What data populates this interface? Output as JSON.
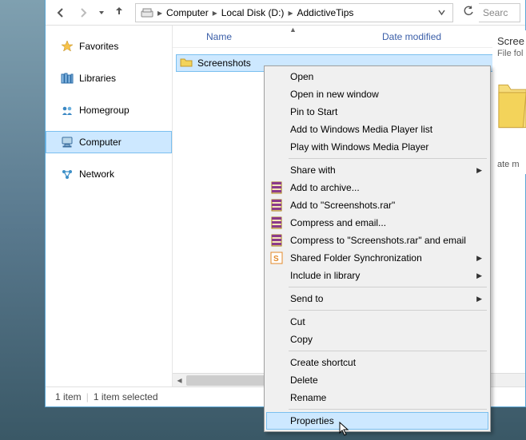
{
  "breadcrumb": {
    "root_icon": "drive",
    "items": [
      "Computer",
      "Local Disk (D:)",
      "AddictiveTips"
    ]
  },
  "search": {
    "placeholder": "Searc"
  },
  "nav_pane": {
    "items": [
      {
        "label": "Favorites",
        "icon": "star"
      },
      {
        "label": "Libraries",
        "icon": "libraries"
      },
      {
        "label": "Homegroup",
        "icon": "homegroup"
      },
      {
        "label": "Computer",
        "icon": "computer",
        "selected": true
      },
      {
        "label": "Network",
        "icon": "network"
      }
    ]
  },
  "columns": {
    "name": "Name",
    "date": "Date modified"
  },
  "file_list": {
    "items": [
      {
        "name": "Screenshots",
        "type": "folder"
      }
    ]
  },
  "preview": {
    "title": "Scree",
    "type_line": "File fol",
    "date_line": "ate m"
  },
  "statusbar": {
    "count": "1 item",
    "selection": "1 item selected"
  },
  "context_menu": {
    "groups": [
      [
        {
          "label": "Open"
        },
        {
          "label": "Open in new window"
        },
        {
          "label": "Pin to Start"
        },
        {
          "label": "Add to Windows Media Player list"
        },
        {
          "label": "Play with Windows Media Player"
        }
      ],
      [
        {
          "label": "Share with",
          "submenu": true
        },
        {
          "label": "Add to archive...",
          "icon": "rar"
        },
        {
          "label": "Add to \"Screenshots.rar\"",
          "icon": "rar"
        },
        {
          "label": "Compress and email...",
          "icon": "rar"
        },
        {
          "label": "Compress to \"Screenshots.rar\" and email",
          "icon": "rar"
        },
        {
          "label": "Shared Folder Synchronization",
          "icon": "s",
          "submenu": true
        },
        {
          "label": "Include in library",
          "submenu": true
        }
      ],
      [
        {
          "label": "Send to",
          "submenu": true
        }
      ],
      [
        {
          "label": "Cut"
        },
        {
          "label": "Copy"
        }
      ],
      [
        {
          "label": "Create shortcut"
        },
        {
          "label": "Delete"
        },
        {
          "label": "Rename"
        }
      ],
      [
        {
          "label": "Properties",
          "hover": true
        }
      ]
    ]
  }
}
